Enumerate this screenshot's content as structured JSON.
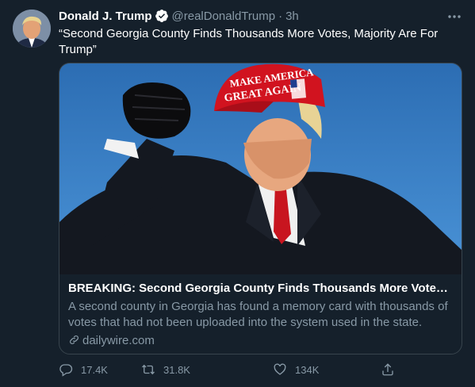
{
  "user": {
    "display_name": "Donald J. Trump",
    "handle": "@realDonaldTrump",
    "separator": "·",
    "time": "3h",
    "avatar_icon": "avatar-portrait",
    "verified_icon": "verified-badge-icon"
  },
  "tweet": {
    "text": "“Second Georgia County Finds Thousands More Votes, Majority Are For Trump”"
  },
  "card": {
    "title": "BREAKING: Second Georgia County Finds Thousands More Votes, Major...",
    "description": "A second county in Georgia has found a memory card with thousands of votes that had not been uploaded into the system used in the state. The...",
    "domain": "dailywire.com",
    "image_hat_text": "GREAT AGAIN",
    "image_hat_text_top": "MAKE AMERICA"
  },
  "actions": {
    "reply_count": "17.4K",
    "retweet_count": "31.8K",
    "like_count": "134K"
  },
  "colors": {
    "background": "#15202b",
    "secondary_text": "#8899a6",
    "border": "#38444d",
    "verified": "#1da1f2"
  }
}
